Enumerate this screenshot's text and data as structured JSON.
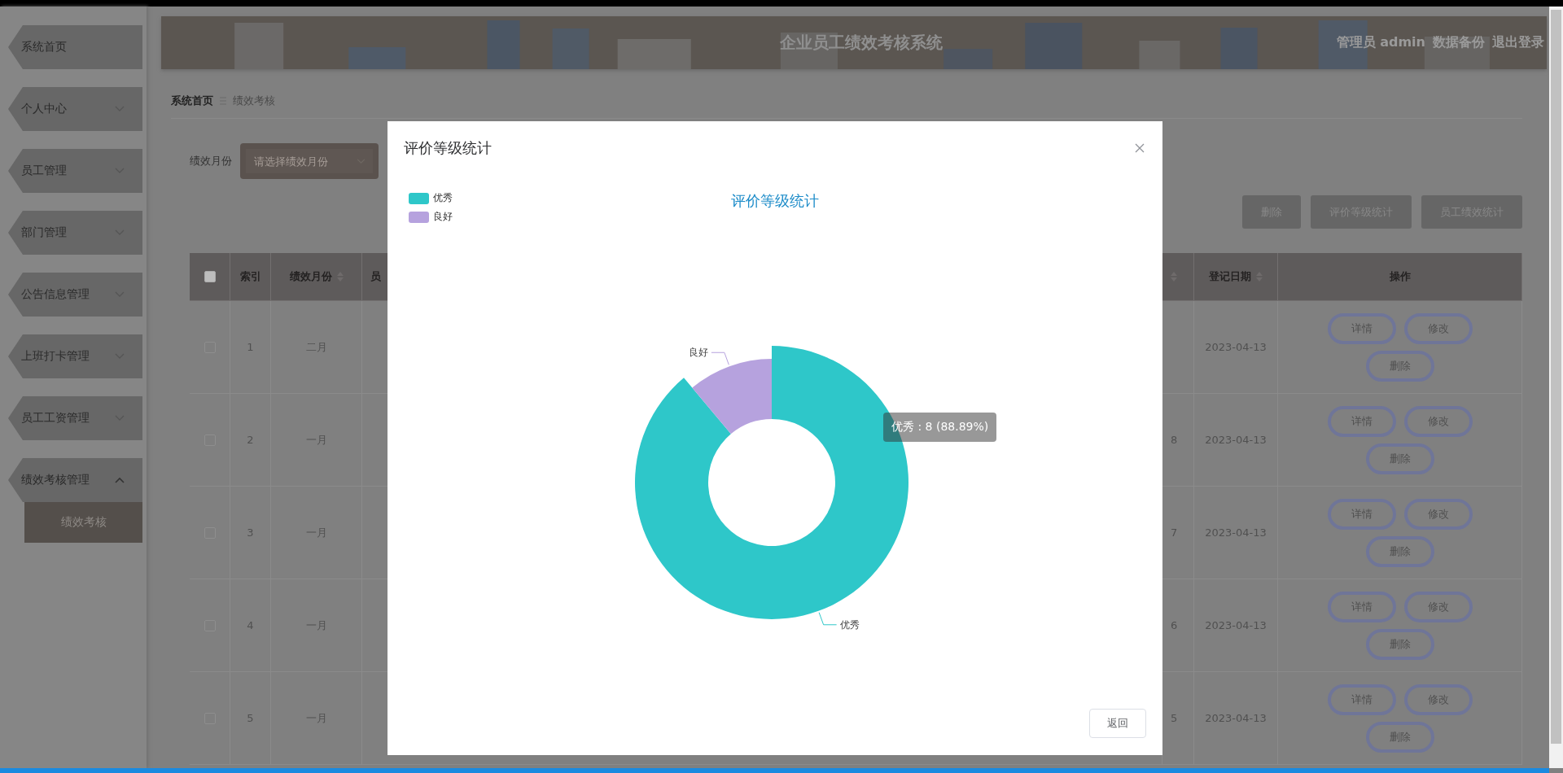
{
  "sidebar": {
    "items": [
      {
        "label": "系统首页"
      },
      {
        "label": "个人中心",
        "expanded": false
      },
      {
        "label": "员工管理",
        "expanded": false
      },
      {
        "label": "部门管理",
        "expanded": false
      },
      {
        "label": "公告信息管理",
        "expanded": false
      },
      {
        "label": "上班打卡管理",
        "expanded": false
      },
      {
        "label": "员工工资管理",
        "expanded": false
      },
      {
        "label": "绩效考核管理",
        "expanded": true,
        "children": [
          {
            "label": "绩效考核",
            "selected": true
          }
        ]
      }
    ]
  },
  "header": {
    "title": "企业员工绩效考核系统",
    "user": "管理员 admin",
    "links": [
      "数据备份",
      "退出登录"
    ]
  },
  "breadcrumb": [
    "系统首页",
    "绩效考核"
  ],
  "filter": {
    "label": "绩效月份",
    "placeholder": "请选择绩效月份"
  },
  "actions": [
    "删除",
    "评价等级统计",
    "员工绩效统计"
  ],
  "table": {
    "header_checked": false,
    "columns": [
      {
        "label": "索引",
        "sortable": false
      },
      {
        "label": "绩效月份",
        "sortable": true
      },
      {
        "label": "员",
        "sortable": false
      },
      {
        "sortable": true
      },
      {
        "label": "登记日期",
        "sortable": true
      },
      {
        "label": "操作",
        "sortable": false
      }
    ],
    "rows": [
      {
        "checked": false,
        "index": "1",
        "month": "二月",
        "column_5": "",
        "date": "2023-04-13",
        "actions": [
          "详情",
          "修改",
          "删除"
        ]
      },
      {
        "checked": false,
        "index": "2",
        "month": "一月",
        "column_5": "8",
        "date": "2023-04-13",
        "actions": [
          "详情",
          "修改",
          "删除"
        ]
      },
      {
        "checked": false,
        "index": "3",
        "month": "一月",
        "column_5": "7",
        "date": "2023-04-13",
        "actions": [
          "详情",
          "修改",
          "删除"
        ]
      },
      {
        "checked": false,
        "index": "4",
        "month": "一月",
        "column_5": "6",
        "date": "2023-04-13",
        "actions": [
          "详情",
          "修改",
          "删除"
        ]
      },
      {
        "checked": false,
        "index": "5",
        "month": "一月",
        "column_5": "5",
        "date": "2023-04-13",
        "actions": [
          "详情",
          "修改",
          "删除"
        ]
      }
    ]
  },
  "dialog": {
    "title": "评价等级统计",
    "legend": [
      {
        "label": "优秀",
        "color": "#2ec7c9"
      },
      {
        "label": "良好",
        "color": "#b6a2de"
      }
    ],
    "chart_data": {
      "type": "donut",
      "title": "评价等级统计",
      "categories": [
        "优秀",
        "良好"
      ],
      "values": [
        88.89,
        11.11
      ]
    },
    "tooltip": "优秀 : 8 (88.89%)",
    "button": "返回"
  }
}
